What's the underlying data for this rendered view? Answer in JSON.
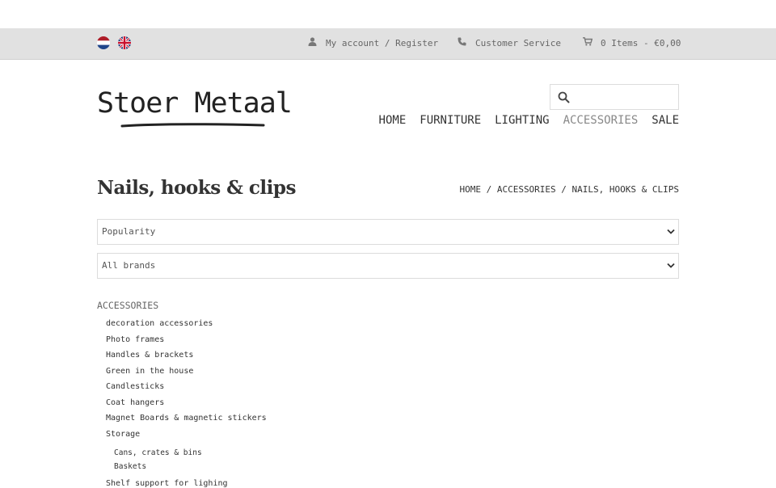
{
  "topbar": {
    "account": "My account / Register",
    "service": "Customer Service",
    "cart": "0 Items - €0,00"
  },
  "logo": {
    "text": "Stoer Metaal"
  },
  "search": {
    "placeholder": ""
  },
  "nav": {
    "items": [
      "HOME",
      "FURNITURE",
      "LIGHTING",
      "ACCESSORIES",
      "SALE"
    ],
    "active": "ACCESSORIES"
  },
  "page": {
    "title": "Nails, hooks & clips",
    "breadcrumb": "HOME / ACCESSORIES / NAILS, HOOKS & CLIPS"
  },
  "filters": {
    "sort": "Popularity",
    "brands": "All brands"
  },
  "categories": {
    "heading": "ACCESSORIES",
    "items": [
      "decoration accessories",
      "Photo frames",
      "Handles & brackets",
      "Green in the house",
      "Candlesticks",
      "Coat hangers",
      "Magnet Boards & magnetic stickers",
      "Storage"
    ],
    "subitems": [
      "Cans, crates & bins",
      "Baskets"
    ],
    "cut_off": "Shelf support for lighing"
  },
  "colors": {
    "topbar": "#e1e1e1",
    "text": "#333333",
    "muted": "#888888"
  }
}
